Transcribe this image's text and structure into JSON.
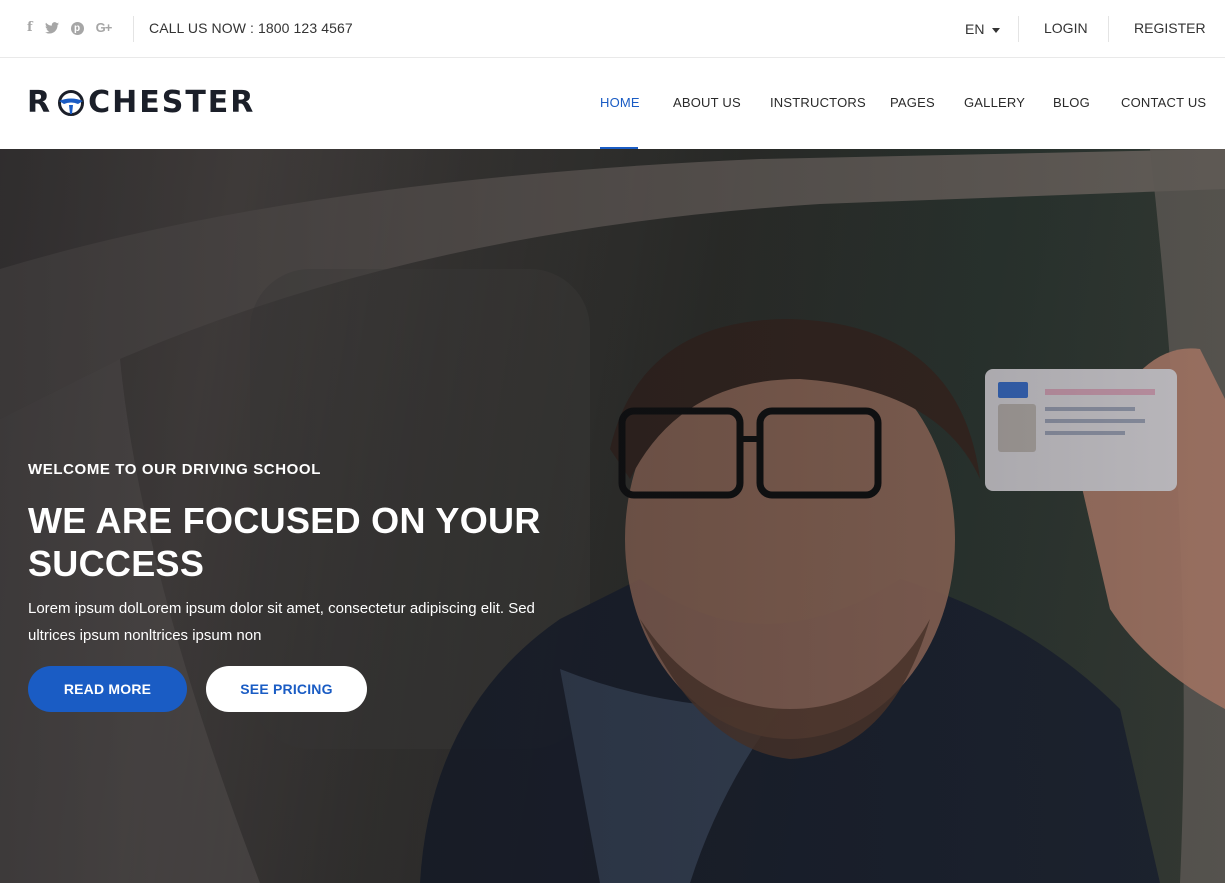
{
  "topbar": {
    "socials": [
      {
        "name": "facebook",
        "glyph": "f"
      },
      {
        "name": "twitter",
        "glyph": ""
      },
      {
        "name": "pinterest",
        "glyph": "p"
      },
      {
        "name": "google-plus",
        "glyph": "G+"
      }
    ],
    "phone": "CALL US NOW : 1800 123 4567",
    "language": "EN",
    "login": "LOGIN",
    "register": "REGISTER"
  },
  "nav": {
    "logo_left": "R",
    "logo_right": "CHESTER",
    "items": [
      "HOME",
      "ABOUT US",
      "INSTRUCTORS",
      "PAGES",
      "GALLERY",
      "BLOG",
      "CONTACT US"
    ],
    "active": "HOME"
  },
  "hero": {
    "eyebrow": "WELCOME TO OUR DRIVING SCHOOL",
    "title": "WE ARE FOCUSED ON YOUR SUCCESS",
    "description": "Lorem ipsum dolLorem ipsum dolor sit amet, consectetur adipiscing elit. Sed ultrices ipsum nonltrices ipsum non",
    "primary_button": "READ MORE",
    "secondary_button": "SEE PRICING"
  },
  "colors": {
    "accent": "#1a5cc4",
    "text_dark": "#1b1f29",
    "icon_gray": "#a6a6a6"
  }
}
